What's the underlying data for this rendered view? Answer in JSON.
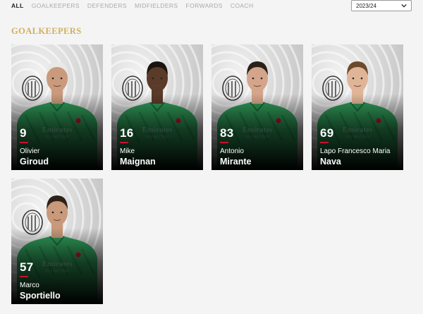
{
  "tabs": [
    "ALL",
    "GOALKEEPERS",
    "DEFENDERS",
    "MIDFIELDERS",
    "FORWARDS",
    "COACH"
  ],
  "season": "2023/24",
  "section_title": "GOALKEEPERS",
  "players": [
    {
      "number": "9",
      "first": "Olivier",
      "last": "Giroud",
      "sponsor": "Emirates",
      "tagline": "FLY BETTER"
    },
    {
      "number": "16",
      "first": "Mike",
      "last": "Maignan",
      "sponsor": "Emirates",
      "tagline": "FLY BETTER"
    },
    {
      "number": "83",
      "first": "Antonio",
      "last": "Mirante",
      "sponsor": "Emirates",
      "tagline": "FLY BETTER"
    },
    {
      "number": "69",
      "first": "Lapo Francesco Maria",
      "last": "Nava",
      "sponsor": "Emirates",
      "tagline": "FLY BETTER"
    },
    {
      "number": "57",
      "first": "Marco",
      "last": "Sportiello",
      "sponsor": "Emirates",
      "tagline": "FLY BETTER"
    }
  ],
  "colors": {
    "accent": "#d2b05a",
    "jersey": "#2f9a58",
    "number_underline": "#c8102e"
  }
}
